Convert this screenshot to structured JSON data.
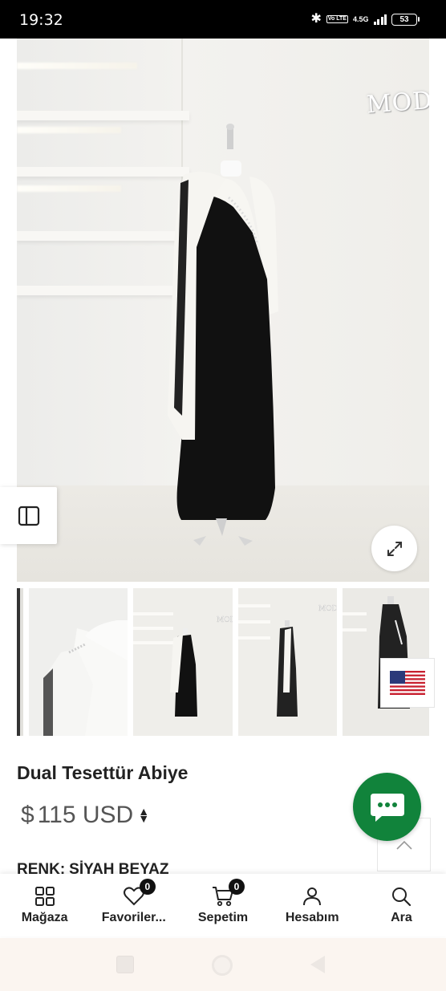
{
  "status_bar": {
    "time": "19:32",
    "network": "4.5G",
    "volte": "Vo LTE",
    "battery": "53"
  },
  "hero": {
    "showroom_sign": "MODA",
    "expand_icon": "expand-arrows-icon"
  },
  "side_tab": {
    "icon": "sidebar-panel-icon"
  },
  "thumbnails": [
    {
      "alt": "shoulder detail"
    },
    {
      "alt": "front view"
    },
    {
      "alt": "angled view"
    },
    {
      "alt": "back view"
    }
  ],
  "currency_flag": {
    "icon": "us-flag-icon"
  },
  "product": {
    "title": "Dual Tesettür Abiye",
    "currency_symbol": "$",
    "price": "115 USD",
    "color_label": "RENK:",
    "color_value": "SİYAH BEYAZ"
  },
  "chat": {
    "icon": "chat-bubble-icon",
    "color": "#11833b"
  },
  "scroll_top": {
    "icon": "chevron-up-icon"
  },
  "bottom_nav": {
    "items": [
      {
        "label": "Mağaza",
        "icon": "grid-icon"
      },
      {
        "label": "Favoriler...",
        "icon": "heart-icon",
        "badge": "0"
      },
      {
        "label": "Sepetim",
        "icon": "cart-icon",
        "badge": "0"
      },
      {
        "label": "Hesabım",
        "icon": "user-icon"
      },
      {
        "label": "Ara",
        "icon": "search-icon"
      }
    ]
  },
  "system_nav": {
    "buttons": [
      "recent-apps",
      "home",
      "back"
    ]
  }
}
